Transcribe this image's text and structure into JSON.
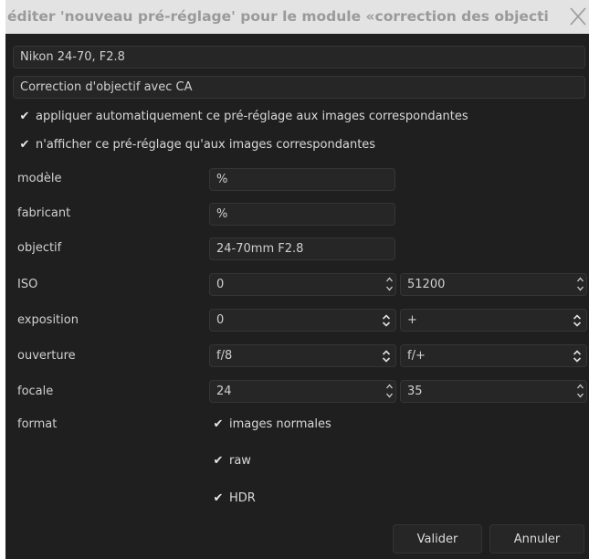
{
  "window": {
    "title": "éditer 'nouveau pré-réglage' pour le module «correction des objecti",
    "close_icon": "close-icon"
  },
  "preset": {
    "name_value": "Nikon 24-70, F2.8",
    "description_value": "Correction d'objectif avec CA",
    "auto_apply_label": "appliquer automatiquement ce pré-réglage aux images correspondantes",
    "auto_apply_checked": true,
    "filter_label": "n'afficher ce pré-réglage qu'aux images correspondantes",
    "filter_checked": true
  },
  "form": {
    "model": {
      "label": "modèle",
      "value": "%"
    },
    "maker": {
      "label": "fabricant",
      "value": "%"
    },
    "lens": {
      "label": "objectif",
      "value": "24-70mm F2.8"
    },
    "iso": {
      "label": "ISO",
      "min": "0",
      "max": "51200"
    },
    "exposure": {
      "label": "exposition",
      "min": "0",
      "max": "+"
    },
    "aperture": {
      "label": "ouverture",
      "min": "f/8",
      "max": "f/+"
    },
    "focal": {
      "label": "focale",
      "min": "24",
      "max": "35"
    },
    "format": {
      "label": "format",
      "normal_label": "images normales",
      "raw_label": "raw",
      "hdr_label": "HDR"
    }
  },
  "buttons": {
    "ok": "Valider",
    "cancel": "Annuler"
  },
  "icons": {
    "check": "✔"
  }
}
